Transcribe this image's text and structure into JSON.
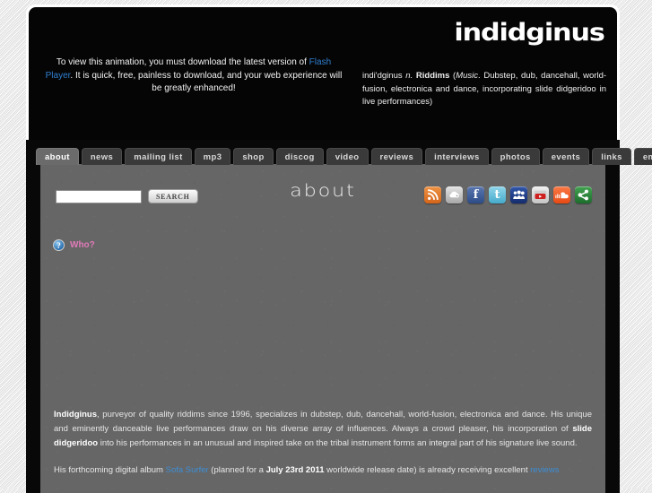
{
  "header": {
    "flash_notice": {
      "pre": "To view this animation, you must download the latest version of ",
      "link": "Flash Player",
      "post": ". It is quick, free, painless to download, and your web experience will be greatly enhanced!"
    },
    "logo": "indidginus",
    "definition": {
      "term": "indi'dginus",
      "pos": "n.",
      "headword": "Riddims",
      "open_paren": "(",
      "field": "Music",
      "body": ". Dubstep, dub, dancehall, world-fusion, electronica and dance, incorporating slide didgeridoo in live performances)"
    }
  },
  "nav": {
    "items": [
      {
        "label": "about",
        "active": true
      },
      {
        "label": "news",
        "active": false
      },
      {
        "label": "mailing list",
        "active": false
      },
      {
        "label": "mp3",
        "active": false
      },
      {
        "label": "shop",
        "active": false
      },
      {
        "label": "discog",
        "active": false
      },
      {
        "label": "video",
        "active": false
      },
      {
        "label": "reviews",
        "active": false
      },
      {
        "label": "interviews",
        "active": false
      },
      {
        "label": "photos",
        "active": false
      },
      {
        "label": "events",
        "active": false
      },
      {
        "label": "links",
        "active": false
      },
      {
        "label": "email",
        "active": false
      }
    ]
  },
  "search": {
    "value": "",
    "placeholder": "",
    "button_label": "SEARCH"
  },
  "main": {
    "page_title": "about",
    "who": {
      "icon_glyph": "?",
      "label": "Who?"
    },
    "social": [
      {
        "name": "rss-icon",
        "title": "RSS",
        "color": "#e07a28"
      },
      {
        "name": "podcast-icon",
        "title": "Podcast",
        "color": "#b8b8b8"
      },
      {
        "name": "facebook-icon",
        "title": "Facebook",
        "color": "#3a5a98",
        "glyph": "f"
      },
      {
        "name": "twitter-icon",
        "title": "Twitter",
        "color": "#63bfdd",
        "glyph": "t"
      },
      {
        "name": "myspace-icon",
        "title": "MySpace",
        "color": "#1f3b86"
      },
      {
        "name": "youtube-icon",
        "title": "YouTube",
        "color": "#dedede"
      },
      {
        "name": "soundcloud-icon",
        "title": "SoundCloud",
        "color": "#f2582a"
      },
      {
        "name": "share-icon",
        "title": "Share",
        "color": "#2f8a3e"
      }
    ],
    "paragraph1": {
      "lead": "Indidginus",
      "text": ", purveyor of quality riddims since 1996, specializes in dubstep, dub, dancehall, world-fusion, electronica and dance. His unique and eminently danceable live performances draw on his diverse array of influences. Always a crowd pleaser, his incorporation of ",
      "bold2": "slide didgeridoo",
      "text2": " into his performances in an unusual and inspired take on the tribal instrument forms an integral part of his signature live sound."
    },
    "paragraph2": {
      "pre": "His forthcoming digital album ",
      "album_link": "Sofa Surfer",
      "mid": " (planned for a ",
      "date": "July 23rd 2011",
      "mid2": " worldwide release date) is already receiving excellent ",
      "reviews_link": "reviews"
    }
  }
}
